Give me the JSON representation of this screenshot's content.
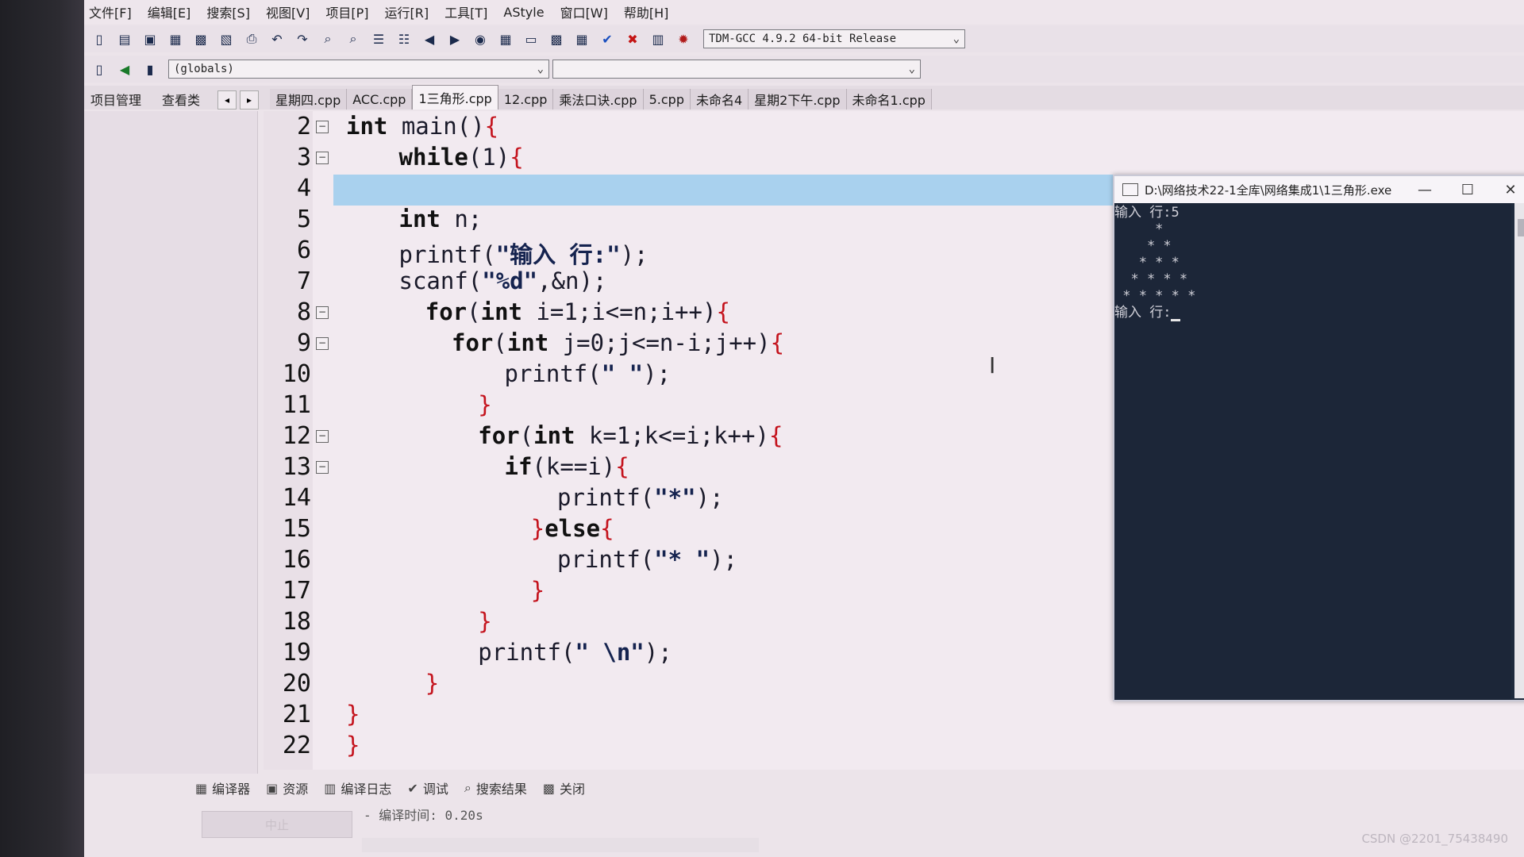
{
  "menu": [
    "文件[F]",
    "编辑[E]",
    "搜索[S]",
    "视图[V]",
    "项目[P]",
    "运行[R]",
    "工具[T]",
    "AStyle",
    "窗口[W]",
    "帮助[H]"
  ],
  "toolbar": {
    "compiler_select": "TDM-GCC 4.9.2 64-bit Release",
    "scope_select": "(globals)",
    "member_select": ""
  },
  "left_tabs": [
    "项目管理",
    "查看类"
  ],
  "file_tabs": [
    "星期四.cpp",
    "ACC.cpp",
    "1三角形.cpp",
    "12.cpp",
    "乘法口诀.cpp",
    "5.cpp",
    "未命名4",
    "星期2下午.cpp",
    "未命名1.cpp"
  ],
  "active_file_tab": "1三角形.cpp",
  "code_lines": [
    {
      "n": "2",
      "fold": "⊟",
      "indent": 0,
      "html": "<span class='kw'>int</span> main()<span class='brace'>{</span>"
    },
    {
      "n": "3",
      "fold": "⊟",
      "indent": 2,
      "html": "<span class='kw'>while</span>(1)<span class='brace'>{</span>"
    },
    {
      "n": "4",
      "fold": "",
      "indent": 0,
      "html": "",
      "highlight": true
    },
    {
      "n": "5",
      "fold": "",
      "indent": 2,
      "html": "<span class='kw'>int</span> n;"
    },
    {
      "n": "6",
      "fold": "",
      "indent": 2,
      "html": "printf(<span class='str'>\"输入 行:\"</span>);"
    },
    {
      "n": "7",
      "fold": "",
      "indent": 2,
      "html": "scanf(<span class='str'>\"%d\"</span>,&amp;n);"
    },
    {
      "n": "8",
      "fold": "⊟",
      "indent": 3,
      "html": "<span class='kw'>for</span>(<span class='kw'>int</span> i=1;i&lt;=n;i++)<span class='brace'>{</span>"
    },
    {
      "n": "9",
      "fold": "⊟",
      "indent": 4,
      "html": "<span class='kw'>for</span>(<span class='kw'>int</span> j=0;j&lt;=n-i;j++)<span class='brace'>{</span>"
    },
    {
      "n": "10",
      "fold": "",
      "indent": 6,
      "html": "printf(<span class='str'>\" \"</span>);"
    },
    {
      "n": "11",
      "fold": "",
      "indent": 5,
      "html": "<span class='brace'>}</span>"
    },
    {
      "n": "12",
      "fold": "⊟",
      "indent": 5,
      "html": "<span class='kw'>for</span>(<span class='kw'>int</span> k=1;k&lt;=i;k++)<span class='brace'>{</span>"
    },
    {
      "n": "13",
      "fold": "⊟",
      "indent": 6,
      "html": "<span class='kw'>if</span>(k==i)<span class='brace'>{</span>"
    },
    {
      "n": "14",
      "fold": "",
      "indent": 8,
      "html": "printf(<span class='str'>\"*\"</span>);"
    },
    {
      "n": "15",
      "fold": "",
      "indent": 7,
      "html": "<span class='brace'>}</span><span class='kw'>else</span><span class='brace'>{</span>"
    },
    {
      "n": "16",
      "fold": "",
      "indent": 8,
      "html": "printf(<span class='str'>\"* \"</span>);"
    },
    {
      "n": "17",
      "fold": "",
      "indent": 7,
      "html": "<span class='brace'>}</span>"
    },
    {
      "n": "18",
      "fold": "",
      "indent": 5,
      "html": "<span class='brace'>}</span>"
    },
    {
      "n": "19",
      "fold": "",
      "indent": 5,
      "html": "printf(<span class='str'>\" \\n\"</span>);"
    },
    {
      "n": "20",
      "fold": "",
      "indent": 3,
      "html": "<span class='brace'>}</span>"
    },
    {
      "n": "21",
      "fold": "",
      "indent": 0,
      "html": "<span class='brace'>}</span>"
    },
    {
      "n": "22",
      "fold": "",
      "indent": 0,
      "html": "<span class='brace'>}</span>"
    }
  ],
  "console": {
    "title": "D:\\网络技术22-1全库\\网络集成1\\1三角形.exe",
    "output": [
      "输入 行:5",
      "     *",
      "    * *",
      "   * * *",
      "  * * * *",
      " * * * * *",
      "输入 行:"
    ]
  },
  "bottom_tabs": [
    "编译器",
    "资源",
    "编译日志",
    "调试",
    "搜索结果",
    "关闭"
  ],
  "stop_label": "中止",
  "compile_log": "- 编译时间: 0.20s",
  "watermark": "CSDN @2201_75438490"
}
